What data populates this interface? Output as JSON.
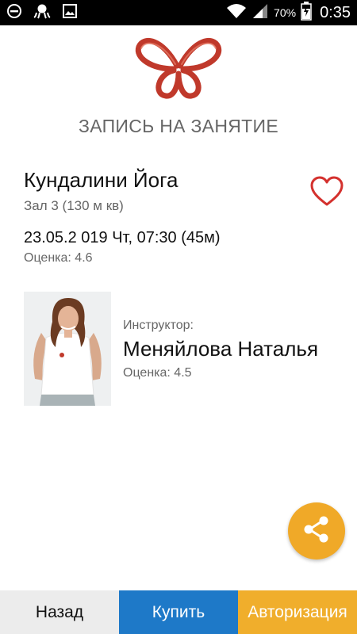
{
  "status_bar": {
    "battery": "70%",
    "time": "0:35"
  },
  "header": {
    "title": "ЗАПИСЬ НА ЗАНЯТИЕ"
  },
  "class_info": {
    "name": "Кундалини Йога",
    "hall": "Зал 3 (130 м кв)",
    "datetime": "23.05.2 019 Чт, 07:30 (45м)",
    "rating": "Оценка: 4.6"
  },
  "instructor": {
    "label": "Инструктор:",
    "name": "Меняйлова Наталья",
    "rating": "Оценка: 4.5"
  },
  "bottom_bar": {
    "back_label": "Назад",
    "buy_label": "Купить",
    "auth_label": "Авторизация"
  },
  "colors": {
    "brand_red": "#C0392B",
    "buy_blue": "#1E79C8",
    "accent_orange": "#F0AE2C",
    "back_grey": "#ECECEC"
  }
}
